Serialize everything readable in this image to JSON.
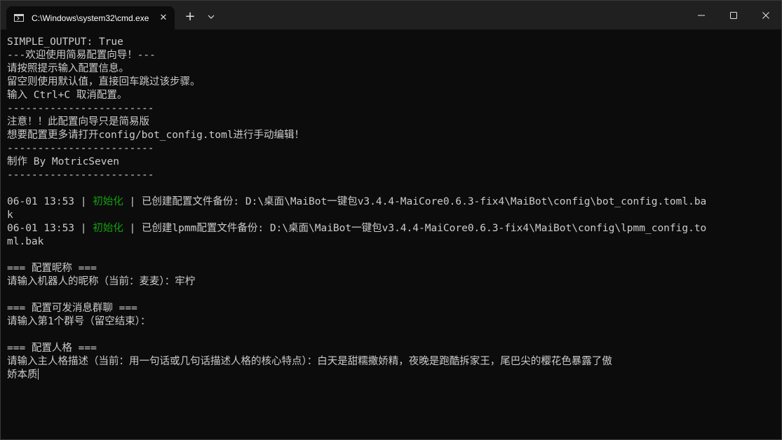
{
  "window": {
    "tab_title": "C:\\Windows\\system32\\cmd.exe",
    "tab_close": "✕",
    "new_tab": "+",
    "icons": [
      "cmd-icon",
      "close-icon",
      "plus-icon",
      "chevron-down-icon",
      "minimize-icon",
      "maximize-icon",
      "close-window-icon"
    ]
  },
  "colors": {
    "background": "#0c0c0c",
    "text": "#cccccc",
    "accent_green": "#13a10e",
    "titlebar": "#202020"
  },
  "console": {
    "l1": "SIMPLE_OUTPUT: True",
    "l2": "---欢迎使用简易配置向导！---",
    "l3": "请按照提示输入配置信息。",
    "l4": "留空则使用默认值，直接回车跳过该步骤。",
    "l5": "输入 Ctrl+C 取消配置。",
    "l6": "------------------------",
    "l7": "注意！！此配置向导只是简易版",
    "l8": "想要配置更多请打开config/bot_config.toml进行手动编辑！",
    "l9": "------------------------",
    "l10": "制作 By MotricSeven",
    "l11": "------------------------",
    "log1": {
      "time": "06-01 13:53",
      "sep1": " | ",
      "level": "初始化",
      "sep2": " | ",
      "message_a": "已创建配置文件备份: D:\\桌面\\MaiBot一键包v3.4.4-MaiCore0.6.3-fix4\\MaiBot\\config\\bot_config.toml.ba",
      "message_b": "k"
    },
    "log2": {
      "time": "06-01 13:53",
      "sep1": " | ",
      "level": "初始化",
      "sep2": " | ",
      "message_a": "已创建lpmm配置文件备份: D:\\桌面\\MaiBot一键包v3.4.4-MaiCore0.6.3-fix4\\MaiBot\\config\\lpmm_config.to",
      "message_b": "ml.bak"
    },
    "s1_head": "=== 配置昵称 ===",
    "s1_prompt": "请输入机器人的昵称（当前：麦麦）：牢柠",
    "s2_head": "=== 配置可发消息群聊 ===",
    "s2_prompt": "请输入第1个群号（留空结束）：",
    "s3_head": "=== 配置人格 ===",
    "s3_prompt_a": "请输入主人格描述（当前：用一句话或几句话描述人格的核心特点）：白天是甜糯撒娇精，夜晚是跑酷拆家王，尾巴尖的樱花色暴露了傲",
    "s3_prompt_b": "娇本质"
  }
}
